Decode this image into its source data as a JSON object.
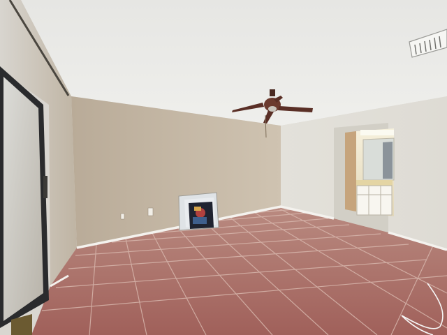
{
  "scene": {
    "subject": "empty-room-photo",
    "colors": {
      "ceiling": "#eaeae7",
      "wall_beige": "#c8b9a6",
      "wall_light": "#e4e3dd",
      "floor_tile": "#a8675f",
      "floor_grout": "#d9b8ae",
      "baseboard": "#f4f2ee",
      "fan_blade": "#5a2f26",
      "bathroom_light": "#f1ead3"
    },
    "objects": [
      {
        "name": "ceiling",
        "icon": "ceiling-shape"
      },
      {
        "name": "ceiling-fan",
        "icon": "fan-icon"
      },
      {
        "name": "air-vent",
        "icon": "vent-icon"
      },
      {
        "name": "sliding-glass-door",
        "icon": "door-icon"
      },
      {
        "name": "framed-picture",
        "icon": "picture-icon"
      },
      {
        "name": "bathroom-doorway",
        "icon": "doorway-icon"
      },
      {
        "name": "bathroom-vanity",
        "icon": "vanity-icon"
      },
      {
        "name": "tile-floor",
        "icon": "tile-icon"
      },
      {
        "name": "cable",
        "icon": "cable-icon"
      }
    ]
  }
}
